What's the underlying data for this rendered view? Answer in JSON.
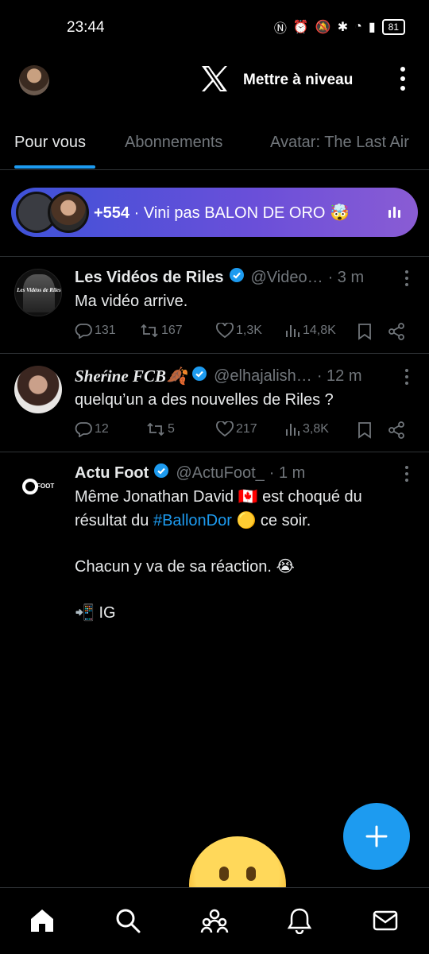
{
  "status_bar": {
    "time": "23:44",
    "battery": "81"
  },
  "header": {
    "upgrade_label": "Mettre à niveau"
  },
  "tabs": [
    {
      "label": "Pour vous",
      "active": true
    },
    {
      "label": "Abonnements",
      "active": false
    },
    {
      "label": "Avatar: The Last Air",
      "active": false
    }
  ],
  "space": {
    "count": "+554",
    "separator": "·",
    "title": "Vini pas BALON DE ORO 🤯"
  },
  "tweets": [
    {
      "name": "Les Vidéos de Riles",
      "handle": "@Video…",
      "time": "· 3 m",
      "avatar_text": "Les Vidéos de Riles",
      "text": "Ma vidéo arrive.",
      "replies": "131",
      "retweets": "167",
      "likes": "1,3K",
      "views": "14,8K"
    },
    {
      "name": "Sheŕine FCB🍂",
      "handle": "@elhajalish…",
      "time": "· 12 m",
      "text": "quelqu’un a des nouvelles de Riles ?",
      "replies": "12",
      "retweets": "5",
      "likes": "217",
      "views": "3,8K"
    },
    {
      "name": "Actu Foot",
      "handle": "@ActuFoot_",
      "time": "· 1 m",
      "avatar_text": "FOOT",
      "text_line1_pre": "Même Jonathan David 🇨🇦 est choqué du",
      "text_line2_pre": "résultat du",
      "hashtag": "#BallonDor",
      "text_line2_post": "🟡 ce soir.",
      "text_line3": "Chacun y va de sa réaction. 😭",
      "text_line4": "📲 IG"
    }
  ],
  "colors": {
    "accent": "#1d9bf0",
    "background": "#000000",
    "muted": "#71767b",
    "text": "#e7e9ea"
  },
  "icons": [
    "x-logo-icon",
    "more-vertical-icon",
    "verified-icon",
    "reply-icon",
    "retweet-icon",
    "like-icon",
    "views-icon",
    "bookmark-icon",
    "share-icon",
    "compose-icon",
    "home-icon",
    "search-icon",
    "communities-icon",
    "notifications-icon",
    "messages-icon"
  ]
}
